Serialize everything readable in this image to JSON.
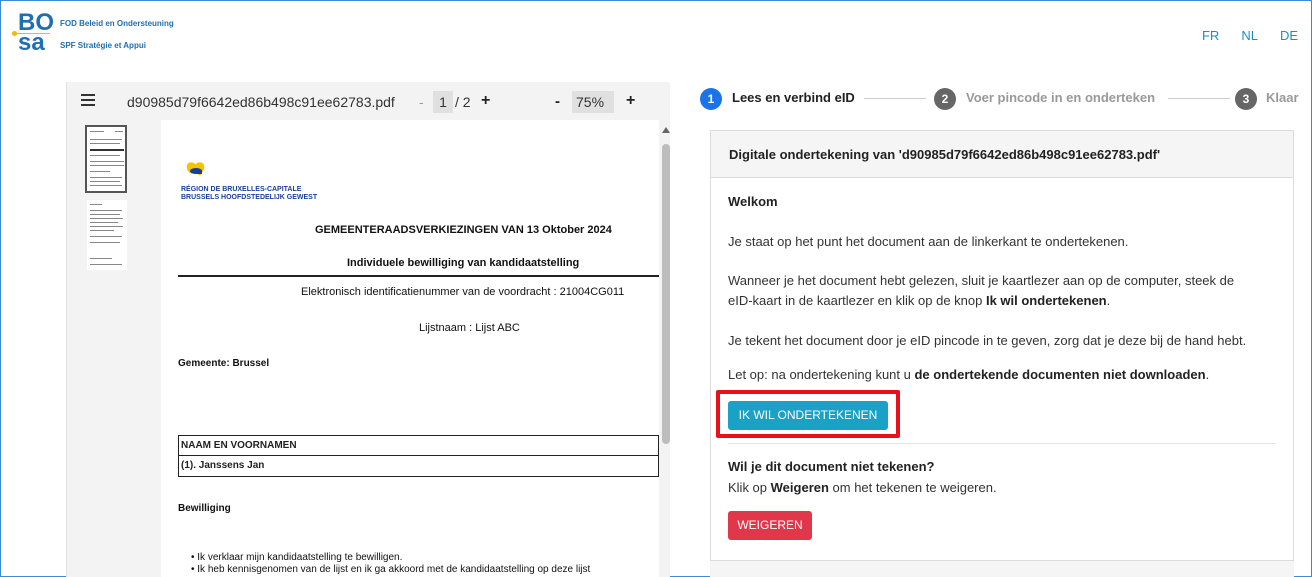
{
  "header": {
    "logo_line1": "BO",
    "logo_line2": "sa",
    "org_nl": "FOD Beleid en Ondersteuning",
    "org_fr": "SPF Stratégie et Appui",
    "languages": [
      "FR",
      "NL",
      "DE"
    ]
  },
  "viewer": {
    "filename": "d90985d79f6642ed86b498c91ee62783.pdf",
    "page_prev": "-",
    "current_page": "1",
    "total_pages": "/ 2",
    "page_next": "+",
    "zoom_out": "-",
    "zoom": "75%",
    "zoom_in": "+"
  },
  "document": {
    "region_fr": "RÉGION DE BRUXELLES-CAPITALE",
    "region_nl": "BRUSSELS HOOFDSTEDELIJK GEWEST",
    "title": "GEMEENTERAADSVERKIEZINGEN VAN 13 Oktober 2024",
    "subtitle": "Individuele bewilliging van kandidaatstelling",
    "ident": "Elektronisch identificatienummer van de voordracht : 21004CG011",
    "list_name": "Lijstnaam : Lijst ABC",
    "municipality": "Gemeente: Brussel",
    "table_header": "NAAM EN VOORNAMEN",
    "table_row": "(1).  Janssens Jan",
    "section": "Bewilliging",
    "bullet1": "•  Ik verklaar mijn kandidaatstelling te bewilligen.",
    "bullet2": "•  Ik heb kennisgenomen van de lijst en ik ga akkoord met de kandidaatstelling op deze lijst"
  },
  "stepper": {
    "steps": [
      {
        "num": "1",
        "label": "Lees en verbind eID"
      },
      {
        "num": "2",
        "label": "Voer pincode in en onderteken"
      },
      {
        "num": "3",
        "label": "Klaar"
      }
    ]
  },
  "card": {
    "title": "Digitale ondertekening van 'd90985d79f6642ed86b498c91ee62783.pdf'",
    "welcome": "Welkom",
    "p1": "Je staat op het punt het document aan de linkerkant te ondertekenen.",
    "p2a": "Wanneer je het document hebt gelezen, sluit je kaartlezer aan op de computer, steek de",
    "p2b_pre": "eID-kaart in de kaartlezer en klik op de knop ",
    "p2b_bold": "Ik wil ondertekenen",
    "p2b_post": ".",
    "p3": "Je tekent het document door je eID pincode in te geven, zorg dat je deze bij de hand hebt.",
    "p4_pre": "Let op: na ondertekening kunt u ",
    "p4_bold": "de ondertekende documenten niet downloaden",
    "p4_post": ".",
    "sign_button": "IK WIL ONDERTEKENEN",
    "refuse_heading": "Wil je dit document niet tekenen?",
    "refuse_pre": "Klik op ",
    "refuse_bold": "Weigeren",
    "refuse_post": " om het tekenen te weigeren.",
    "refuse_button": "WEIGEREN"
  },
  "colors": {
    "accent": "#1ba1c6",
    "step_active": "#1a73e8",
    "step_inactive": "#666666",
    "danger": "#e1374b",
    "highlight": "#e8101b",
    "brand": "#1f6fb2"
  }
}
